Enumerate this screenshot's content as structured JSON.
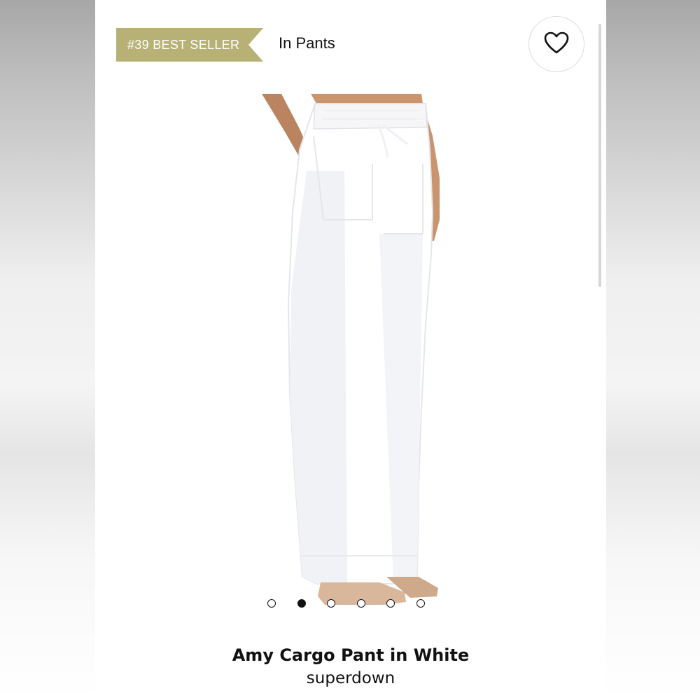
{
  "header": {
    "badge_label": "#39 BEST SELLER",
    "category_label": "In Pants",
    "favorite_icon": "heart-icon"
  },
  "gallery": {
    "dot_count": 6,
    "active_index": 1
  },
  "product": {
    "name": "Amy Cargo Pant in White",
    "brand": "superdown"
  },
  "colors": {
    "badge": "#b7b175",
    "text": "#111111",
    "background": "#ffffff"
  }
}
